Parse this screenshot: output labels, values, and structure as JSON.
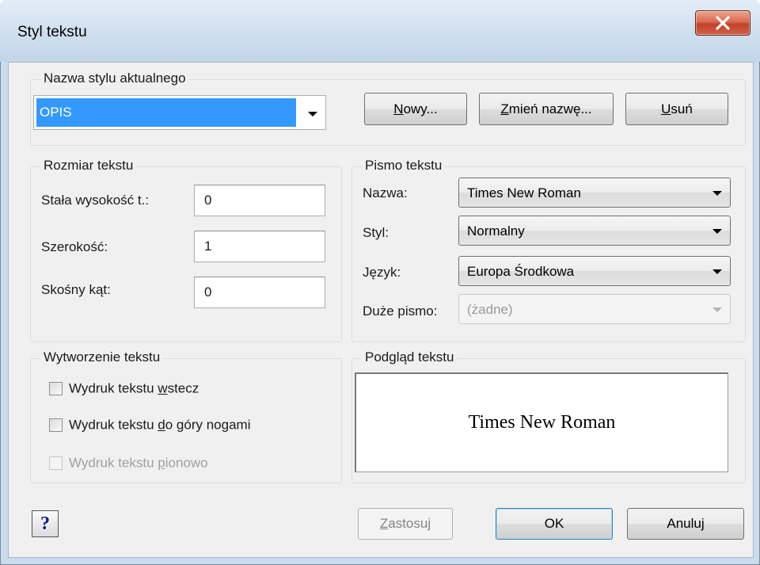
{
  "window": {
    "title": "Styl tekstu",
    "close_label": "close"
  },
  "current_style": {
    "group_label": "Nazwa stylu aktualnego",
    "value": "OPIS",
    "buttons": {
      "new": "Nowy...",
      "rename": "Zmień nazwę...",
      "delete": "Usuń"
    }
  },
  "text_size": {
    "group_label": "Rozmiar tekstu",
    "height_label": "Stała wysokość t.:",
    "height_value": "0",
    "width_label": "Szerokość:",
    "width_value": "1",
    "oblique_label": "Skośny kąt:",
    "oblique_value": "0"
  },
  "font": {
    "group_label": "Pismo tekstu",
    "name_label": "Nazwa:",
    "name_value": "Times New Roman",
    "style_label": "Styl:",
    "style_value": "Normalny",
    "lang_label": "Język:",
    "lang_value": "Europa Środkowa",
    "bigfont_label": "Duże pismo:",
    "bigfont_value": "(żadne)"
  },
  "generation": {
    "group_label": "Wytworzenie tekstu",
    "backwards": {
      "pre": "Wydruk tekstu ",
      "accel": "w",
      "post": "stecz",
      "checked": false
    },
    "upside_down": {
      "pre": "Wydruk tekstu ",
      "accel": "d",
      "post": "o góry nogami",
      "checked": false
    },
    "vertical": {
      "pre": "Wydruk tekstu ",
      "accel": "p",
      "post": "ionowo",
      "checked": false,
      "disabled": true
    }
  },
  "preview": {
    "group_label": "Podgląd tekstu",
    "sample": "Times New Roman"
  },
  "footer": {
    "help": "?",
    "apply": {
      "accel": "Z",
      "rest": "astosuj"
    },
    "ok": "OK",
    "cancel": "Anuluj"
  },
  "colors": {
    "selection": "#3399ff",
    "close_button": "#c0432a",
    "titlebar": "#d2e1f0",
    "dialog_bg": "#f0f0f0"
  }
}
